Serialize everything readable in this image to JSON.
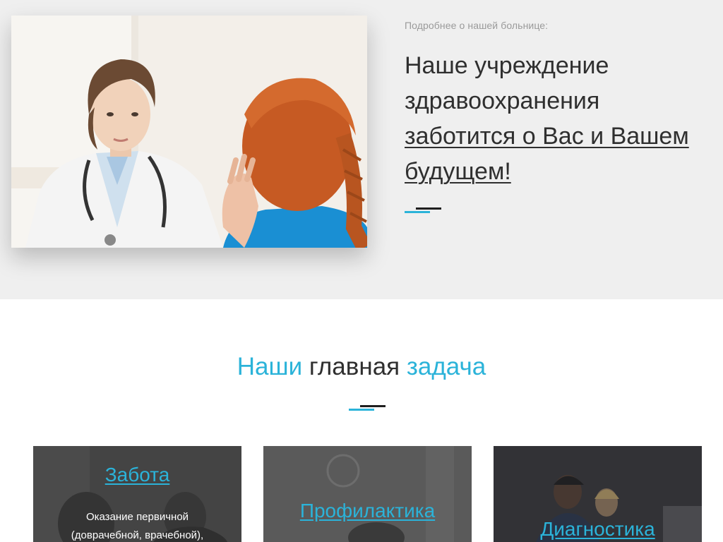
{
  "about": {
    "kicker": "Подробнее о нашей больнице:",
    "heading_plain": "Наше учреждение здравоохранения",
    "heading_link": "заботится о Вас и Вашем будущем!"
  },
  "mission": {
    "title_part1": "Наши",
    "title_part2": "главная",
    "title_part3": "задача"
  },
  "cards": [
    {
      "title": "Забота",
      "desc_line1": "Оказание первичной",
      "desc_line2": "(доврачебной, врачебной),"
    },
    {
      "title": "Профилактика"
    },
    {
      "title": "Диагностика"
    }
  ],
  "colors": {
    "accent": "#2bb3d9",
    "band": "#efefef",
    "text": "#2f2f2f"
  }
}
